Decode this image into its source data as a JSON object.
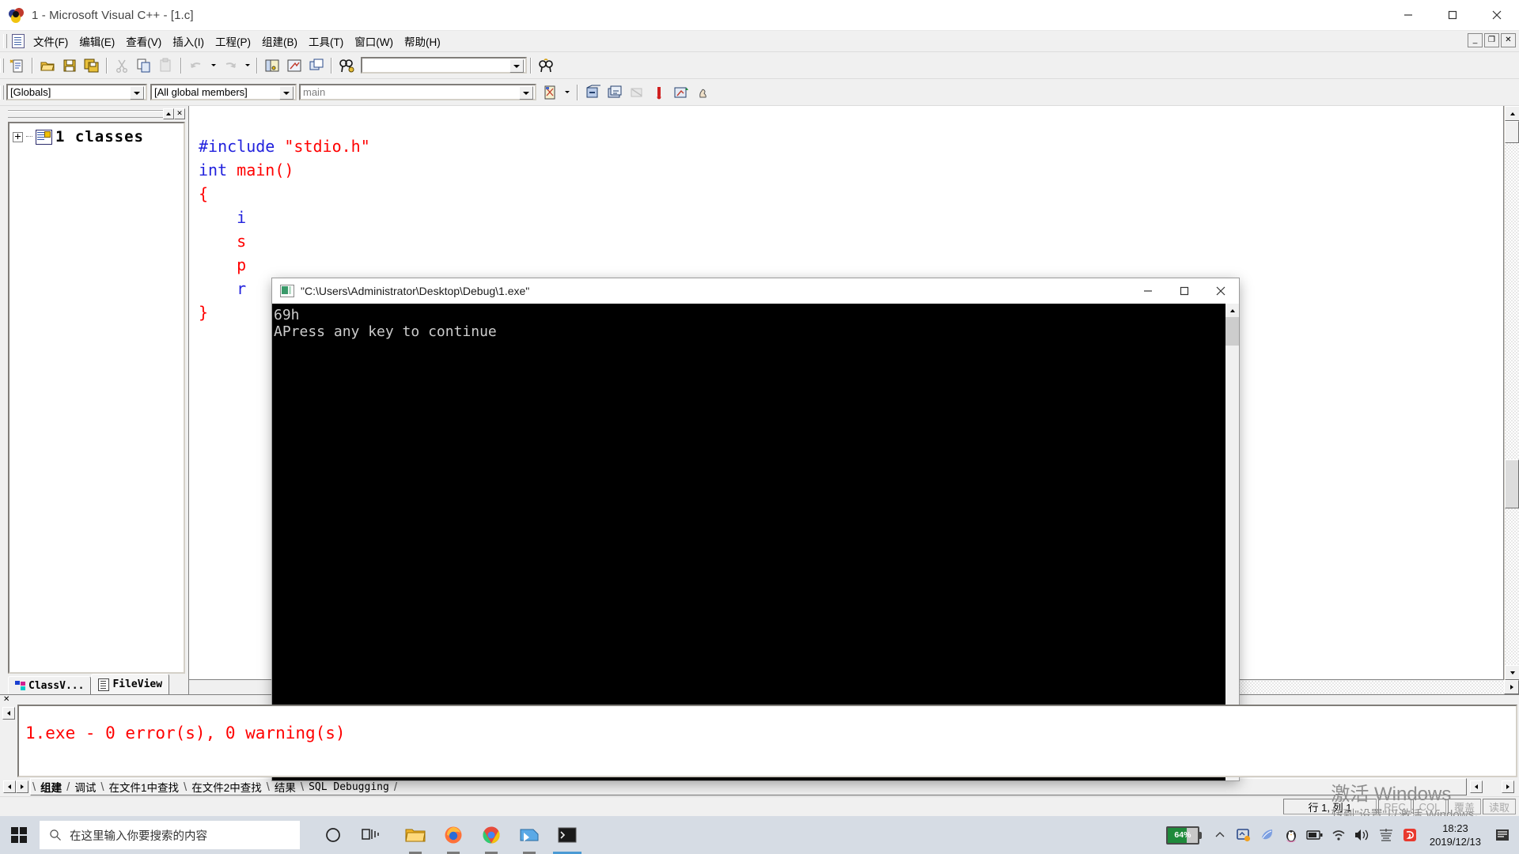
{
  "window": {
    "title": "1 - Microsoft Visual C++ - [1.c]",
    "app_icon": "vcpp-icon",
    "minimize": "—",
    "maximize": "□",
    "close": "✕"
  },
  "menubar": {
    "doc_icon": "document-icon",
    "items": [
      {
        "label": "文件(F)"
      },
      {
        "label": "编辑(E)"
      },
      {
        "label": "查看(V)"
      },
      {
        "label": "插入(I)"
      },
      {
        "label": "工程(P)"
      },
      {
        "label": "组建(B)"
      },
      {
        "label": "工具(T)"
      },
      {
        "label": "窗口(W)"
      },
      {
        "label": "帮助(H)"
      }
    ],
    "mdi_buttons": [
      {
        "name": "mdi-minimize",
        "glyph": "_"
      },
      {
        "name": "mdi-restore",
        "glyph": "❐"
      },
      {
        "name": "mdi-close",
        "glyph": "✕"
      }
    ]
  },
  "toolbar_standard": {
    "buttons": [
      {
        "name": "new-text-file-icon"
      },
      {
        "name": "open-folder-icon"
      },
      {
        "name": "save-icon"
      },
      {
        "name": "save-all-icon"
      },
      {
        "name": "cut-icon"
      },
      {
        "name": "copy-icon"
      },
      {
        "name": "paste-icon"
      },
      {
        "name": "undo-icon"
      },
      {
        "name": "redo-icon"
      },
      {
        "name": "workspace-window-icon"
      },
      {
        "name": "output-window-icon"
      },
      {
        "name": "windows-list-icon"
      },
      {
        "name": "find-in-files-icon"
      }
    ],
    "find_box_value": "",
    "find_box_placeholder": "",
    "find_icon": "binoculars-icon"
  },
  "toolbar_wizardbar": {
    "class_combo": "[Globals]",
    "members_combo": "[All global members]",
    "function_combo": "main",
    "action_icon": "wizard-action-icon",
    "buttons": [
      {
        "name": "compile-icon"
      },
      {
        "name": "build-icon"
      },
      {
        "name": "stop-build-icon"
      },
      {
        "name": "execute-program-icon"
      },
      {
        "name": "go-debug-icon"
      },
      {
        "name": "insert-breakpoint-icon"
      }
    ]
  },
  "workspace": {
    "tree": {
      "expander": "plus-box",
      "icon": "classes-folder-icon",
      "label": "1 classes"
    },
    "tabs": [
      {
        "label": "ClassV...",
        "icon": "classview-icon",
        "active": false
      },
      {
        "label": "FileView",
        "icon": "fileview-icon",
        "active": true
      }
    ],
    "scroll_left": "scroll-left-arrow",
    "scroll_right": "scroll-right-arrow",
    "collapse": "collapse-arrow",
    "close": "close-x"
  },
  "editor": {
    "lines": [
      [
        {
          "t": "#include ",
          "c": "kw"
        },
        {
          "t": "\"stdio.h\"",
          "c": "str"
        }
      ],
      [
        {
          "t": "int ",
          "c": "kw"
        },
        {
          "t": "main()",
          "c": "str"
        }
      ],
      [
        {
          "t": "{",
          "c": "str"
        }
      ],
      [
        {
          "t": "    i",
          "c": "kw"
        }
      ],
      [
        {
          "t": "    s",
          "c": "str"
        }
      ],
      [
        {
          "t": "    p",
          "c": "str"
        }
      ],
      [
        {
          "t": "    r",
          "c": "kw"
        }
      ],
      [
        {
          "t": "}",
          "c": "str"
        }
      ]
    ]
  },
  "console": {
    "title": "\"C:\\Users\\Administrator\\Desktop\\Debug\\1.exe\"",
    "icon": "console-icon",
    "minimize": "—",
    "maximize": "□",
    "close": "✕",
    "output": "69h\nAPress any key to continue"
  },
  "output_pane": {
    "close_glyph": "✕",
    "text": "1.exe - 0 error(s), 0 warning(s)",
    "tabs": [
      {
        "label": "组建",
        "active": true,
        "mono": false
      },
      {
        "label": "调试",
        "active": false,
        "mono": false
      },
      {
        "label": "在文件1中查找",
        "active": false,
        "mono": false
      },
      {
        "label": "在文件2中查找",
        "active": false,
        "mono": false
      },
      {
        "label": "结果",
        "active": false,
        "mono": false
      },
      {
        "label": "SQL Debugging",
        "active": false,
        "mono": true
      }
    ]
  },
  "statusbar": {
    "position": "行 1, 列 1",
    "indicators": [
      {
        "label": "REC",
        "dim": true
      },
      {
        "label": "COL",
        "dim": true
      },
      {
        "label": "覆盖",
        "dim": true
      },
      {
        "label": "读取",
        "dim": true
      }
    ]
  },
  "watermark": {
    "line1": "激活 Windows",
    "line2": "转到\"设置\"以激活 Windows。"
  },
  "taskbar": {
    "start_icon": "windows-start-icon",
    "search_placeholder": "在这里输入你要搜索的内容",
    "search_icon": "search-icon",
    "items": [
      {
        "name": "cortana-icon"
      },
      {
        "name": "task-view-icon"
      },
      {
        "name": "file-explorer-icon"
      },
      {
        "name": "firefox-icon"
      },
      {
        "name": "chrome-icon"
      },
      {
        "name": "visual-cpp-icon"
      },
      {
        "name": "console-window-icon"
      }
    ],
    "tray": {
      "battery_percent": "64%",
      "show_hidden_icon": "chevron-up-icon",
      "icons": [
        {
          "name": "screenshot-tool-icon"
        },
        {
          "name": "leaf-icon"
        },
        {
          "name": "qq-penguin-icon"
        },
        {
          "name": "battery-icon"
        },
        {
          "name": "wifi-icon"
        },
        {
          "name": "volume-icon"
        },
        {
          "name": "ime-icon"
        },
        {
          "name": "sogou-input-icon"
        }
      ],
      "time": "18:23",
      "date": "2019/12/13",
      "action_center_icon": "notification-center-icon"
    }
  },
  "colors": {
    "keyword_blue": "#2222dd",
    "string_red": "#ff0000",
    "error_red": "#ff0000",
    "chrome_gray": "#f0f0f0",
    "taskbar": "#d6dce4",
    "battery_green": "#1f8a3b"
  }
}
